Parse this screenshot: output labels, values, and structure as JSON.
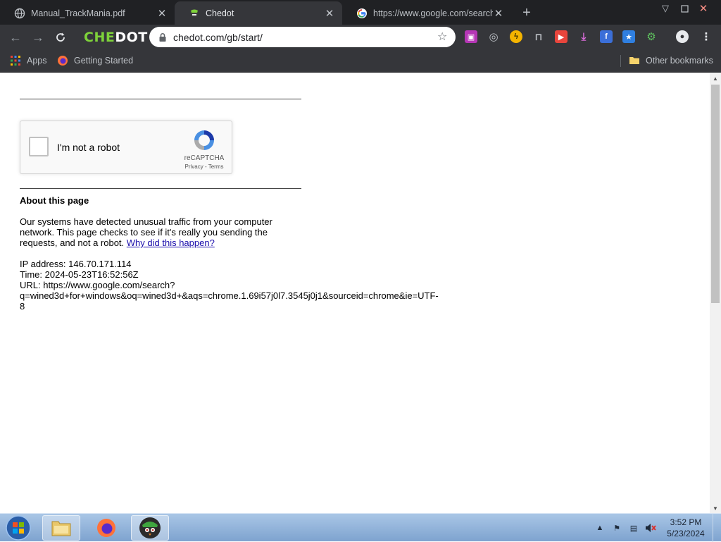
{
  "tabs": [
    {
      "title": "Manual_TrackMania.pdf",
      "active": false
    },
    {
      "title": "Chedot",
      "active": true
    },
    {
      "title": "https://www.google.com/search?",
      "active": false
    }
  ],
  "toolbar": {
    "brand": {
      "part1": "CHE",
      "part2": "D",
      "part3": "OT"
    },
    "url": "chedot.com/gb/start/"
  },
  "bookmarks": {
    "apps": "Apps",
    "getting_started": "Getting Started",
    "other": "Other bookmarks"
  },
  "recaptcha": {
    "label": "I'm not a robot",
    "brand": "reCAPTCHA",
    "links": "Privacy - Terms"
  },
  "about": {
    "title": "About this page",
    "p1": "Our systems have detected unusual traffic from your computer network. This page checks to see if it's really you sending the requests, and not a robot.",
    "why_link": "Why did this happen?",
    "ip_line": "IP address: 146.70.171.114",
    "time_line": "Time: 2024-05-23T16:52:56Z",
    "url_line": "URL: https://www.google.com/search?",
    "url_query": "q=wined3d+for+windows&oq=wined3d+&aqs=chrome.1.69i57j0l7.3545j0j1&sourceid=chrome&ie=UTF-",
    "url_tail": "8"
  },
  "taskbar": {
    "time": "3:52 PM",
    "date": "5/23/2024"
  },
  "colors": {
    "tab_strip": "#202124",
    "toolbar": "#35363a",
    "brand_green": "#7ed23a",
    "link": "#1a0dab"
  }
}
